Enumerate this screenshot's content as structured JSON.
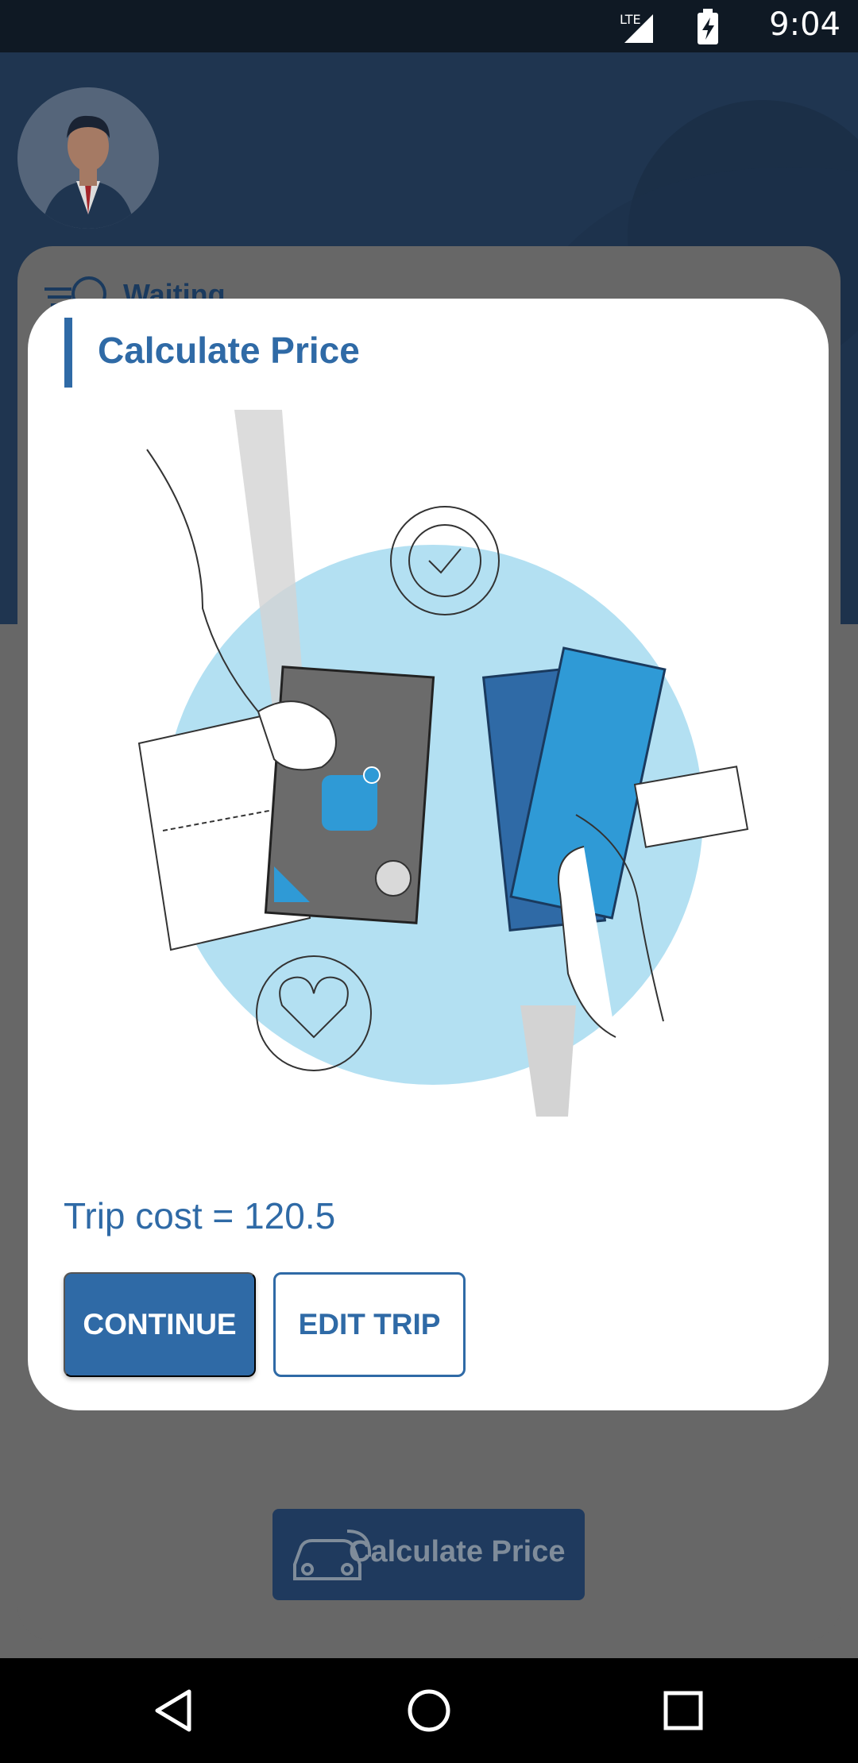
{
  "status_bar": {
    "time": "9:04",
    "network": "LTE",
    "icons": [
      "lte-signal-icon",
      "battery-charging-icon"
    ]
  },
  "background": {
    "waiting_label": "Waiting",
    "calculate_button_label": "Calculate Price"
  },
  "dialog": {
    "title": "Calculate Price",
    "trip_cost": "Trip cost = 120.5",
    "continue_label": "CONTINUE",
    "edit_label": "EDIT TRIP"
  },
  "nav": {
    "buttons": [
      "back-icon",
      "home-icon",
      "recents-icon"
    ]
  },
  "colors": {
    "accent": "#2f6aa6",
    "header": "#1f3550",
    "illustration_blue": "#b3e0f2",
    "overlay": "#676767"
  }
}
